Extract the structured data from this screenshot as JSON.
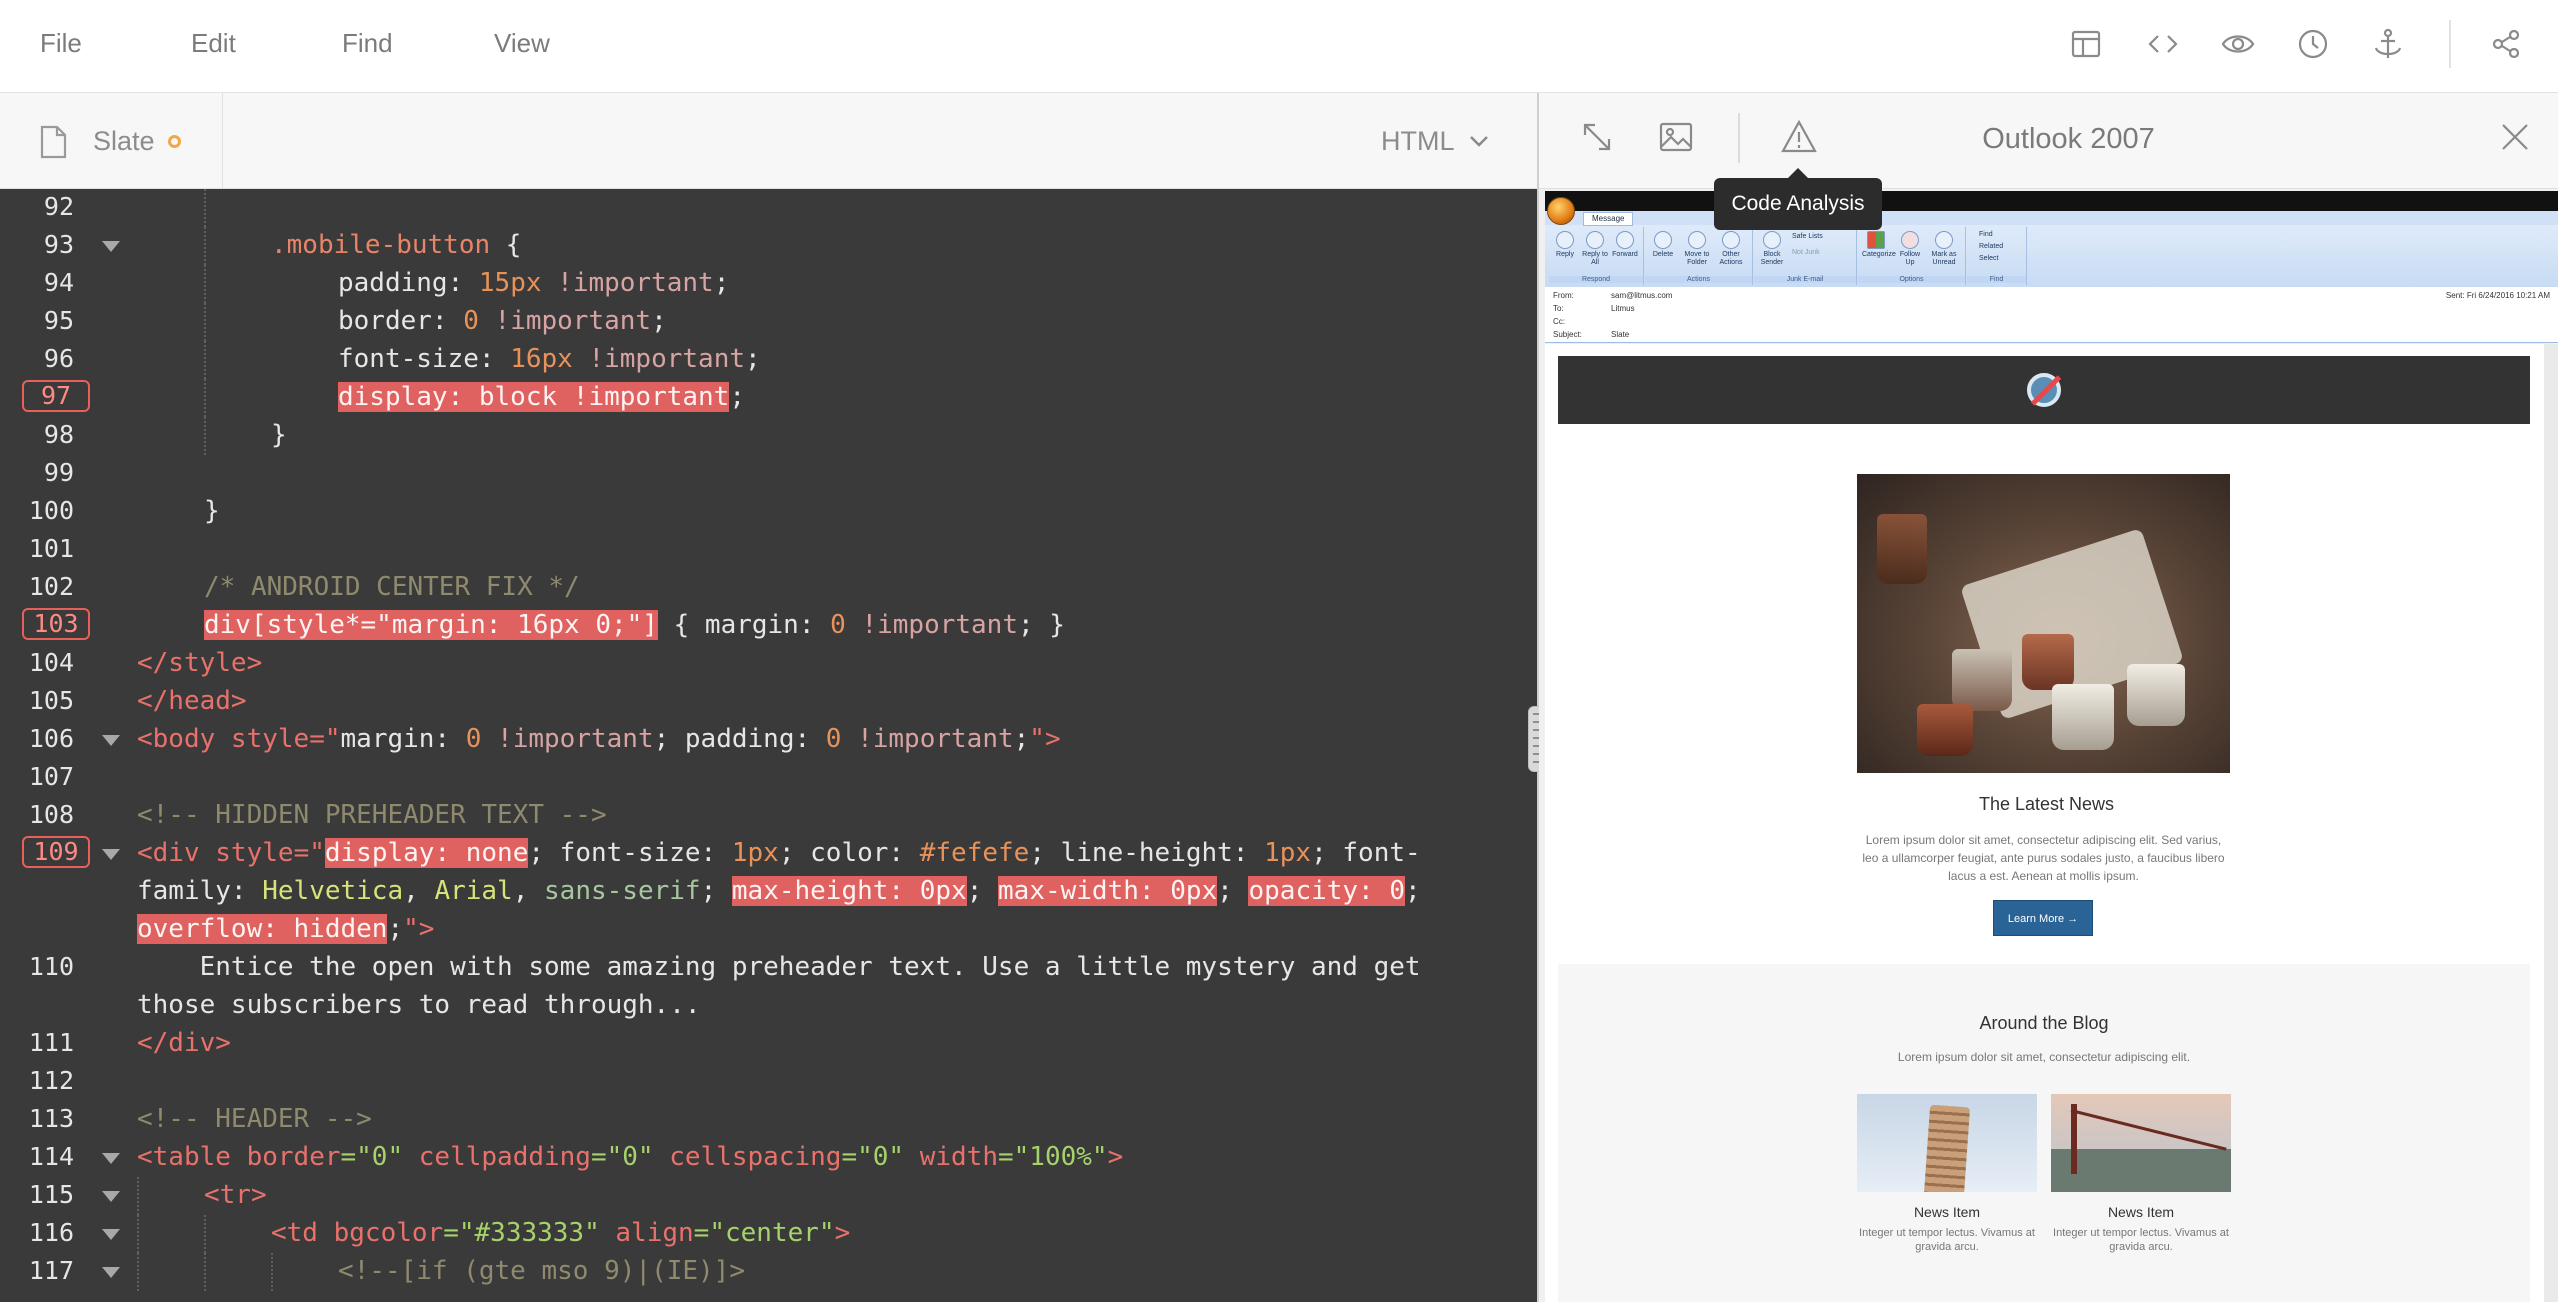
{
  "menu": {
    "file": "File",
    "edit": "Edit",
    "find": "Find",
    "view": "View"
  },
  "toolbar_icons": [
    "layout-icon",
    "code-icon",
    "eye-icon",
    "history-icon",
    "anchor-icon",
    "share-icon"
  ],
  "editor": {
    "file_name": "Slate",
    "language": "HTML",
    "lines": {
      "l92": {
        "num": "92"
      },
      "l93": {
        "num": "93",
        "sel": ".mobile-button",
        "rest": " {"
      },
      "l94": {
        "num": "94",
        "prop": "padding: ",
        "val": "15px",
        "imp": " !important",
        "end": ";"
      },
      "l95": {
        "num": "95",
        "prop": "border: ",
        "val": "0",
        "imp": " !important",
        "end": ";"
      },
      "l96": {
        "num": "96",
        "prop": "font-size: ",
        "val": "16px",
        "imp": " !important",
        "end": ";"
      },
      "l97": {
        "num": "97",
        "hl": "display: block !important",
        "end": ";"
      },
      "l98": {
        "num": "98",
        "text": "}"
      },
      "l99": {
        "num": "99"
      },
      "l100": {
        "num": "100",
        "text": "}"
      },
      "l101": {
        "num": "101"
      },
      "l102": {
        "num": "102",
        "comment": "/* ANDROID CENTER FIX */"
      },
      "l103": {
        "num": "103",
        "hl": "div[style*=\"margin: 16px 0;\"]",
        "a": " { margin: ",
        "v": "0",
        "i": " !important",
        "e": "; }"
      },
      "l104": {
        "num": "104",
        "tag": "</style>"
      },
      "l105": {
        "num": "105",
        "tag": "</head>"
      },
      "l106": {
        "num": "106",
        "t1": "<body ",
        "a1": "style",
        "s1": "=\"",
        "p1": "margin: ",
        "v1": "0",
        "i1": " !important",
        "p2": "; padding: ",
        "v2": "0",
        "i2": " !important",
        "p3": ";",
        "s2": "\"",
        "t2": ">"
      },
      "l107": {
        "num": "107"
      },
      "l108": {
        "num": "108",
        "comment": "<!-- HIDDEN PREHEADER TEXT -->"
      },
      "l109": {
        "num": "109",
        "t1": "<div ",
        "a1": "style",
        "s1": "=\"",
        "hl1": "display: none",
        "p1": "; font-size: ",
        "v1": "1px",
        "p2": "; color: ",
        "v2": "#fefefe",
        "p3": "; line-height: ",
        "v3": "1px",
        "p4": "; font-"
      },
      "l109b": {
        "p1": "family: ",
        "f1": "Helvetica",
        "p2": ", ",
        "f2": "Arial",
        "p3": ", ",
        "f3": "sans-serif",
        "p4": "; ",
        "hl1": "max-height: 0px",
        "p5": "; ",
        "hl2": "max-width: 0px",
        "p6": "; ",
        "hl3": "opacity: 0",
        "p7": ";"
      },
      "l109c": {
        "hl1": "overflow: hidden",
        "p1": ";",
        "s1": "\"",
        "t1": ">"
      },
      "l110": {
        "num": "110",
        "text": "    Entice the open with some amazing preheader text. Use a little mystery and get"
      },
      "l110b": {
        "text": "those subscribers to read through..."
      },
      "l111": {
        "num": "111",
        "tag": "</div>"
      },
      "l112": {
        "num": "112"
      },
      "l113": {
        "num": "113",
        "comment": "<!-- HEADER -->"
      },
      "l114": {
        "num": "114",
        "t1": "<table ",
        "a1": "border",
        "s1": "=\"0\"",
        "a2": " cellpadding",
        "s2": "=\"0\"",
        "a3": " cellspacing",
        "s3": "=\"0\"",
        "a4": " width",
        "s4": "=\"100%\"",
        "t2": ">"
      },
      "l115": {
        "num": "115",
        "tag": "<tr>"
      },
      "l116": {
        "num": "116",
        "t1": "<td ",
        "a1": "bgcolor",
        "s1": "=\"#333333\"",
        "a2": " align",
        "s2": "=\"center\"",
        "t2": ">"
      },
      "l117": {
        "num": "117",
        "comment": "<!--[if (gte mso 9)|(IE)]>"
      }
    }
  },
  "preview": {
    "client": "Outlook 2007",
    "tooltip": "Code Analysis",
    "outlook": {
      "tab": "Message",
      "groups": [
        "Respond",
        "Actions",
        "Junk E-mail",
        "Options",
        "Find"
      ],
      "buttons": [
        "Reply",
        "Reply to All",
        "Forward",
        "Delete",
        "Move to Folder",
        "Other Actions",
        "Block Sender",
        "Categorize",
        "Follow Up",
        "Mark as Unread"
      ],
      "side_buttons": [
        "Safe Lists",
        "Not Junk",
        "Find",
        "Related",
        "Select"
      ],
      "from_label": "From:",
      "from": "sam@litmus.com",
      "to_label": "To:",
      "to": "Litmus",
      "cc_label": "Cc:",
      "subject_label": "Subject:",
      "subject": "Slate",
      "sent": "Sent:   Fri 6/24/2016 10:21 AM"
    },
    "email": {
      "headline": "The Latest News",
      "body": "Lorem ipsum dolor sit amet, consectetur adipiscing elit. Sed varius, leo a ullamcorper feugiat, ante purus sodales justo, a faucibus libero lacus a est. Aenean at mollis ipsum.",
      "button": "Learn More →",
      "blog_title": "Around the Blog",
      "blog_sub": "Lorem ipsum dolor sit amet, consectetur adipiscing elit.",
      "news": [
        {
          "title": "News Item",
          "text": "Integer ut tempor lectus. Vivamus at gravida arcu."
        },
        {
          "title": "News Item",
          "text": "Integer ut tempor lectus. Vivamus at gravida arcu."
        }
      ]
    }
  }
}
